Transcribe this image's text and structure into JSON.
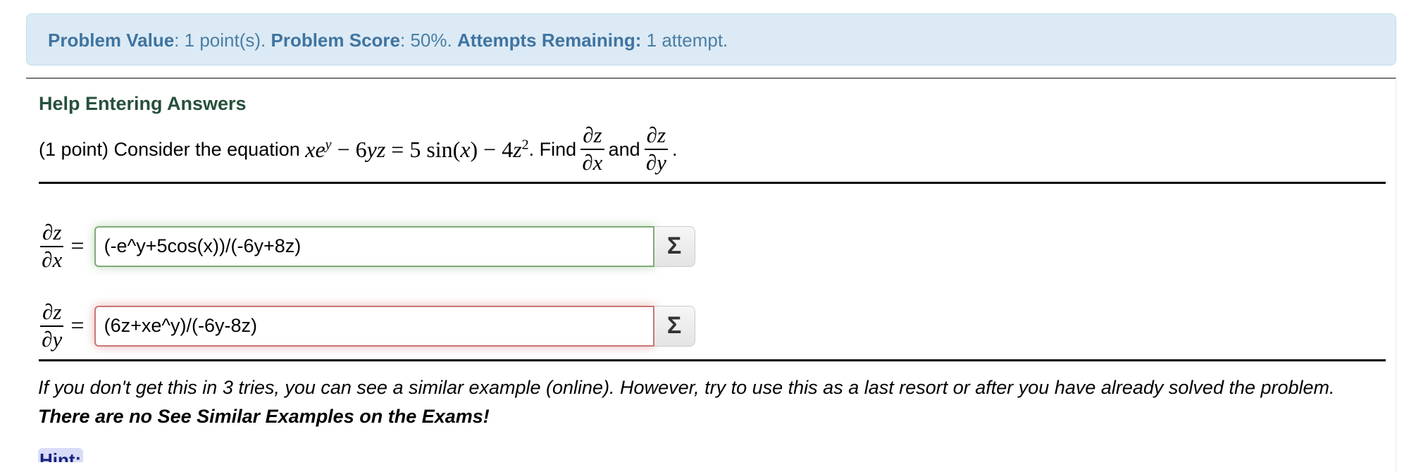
{
  "status": {
    "problem_value_label": "Problem Value",
    "problem_value": ": 1 point(s).",
    "problem_score_label": "Problem Score",
    "problem_score": ": 50%.",
    "attempts_label": "Attempts Remaining:",
    "attempts": " 1 attempt."
  },
  "help_link": "Help Entering Answers",
  "question": {
    "prefix": "(1 point) Consider the equation",
    "equation": {
      "lhs1": "xe",
      "lhs1_sup": "y",
      "minus": "−",
      "lhs2": "6yz",
      "equals": "=",
      "rhs1": "5 sin(",
      "rhs1_var": "x",
      "rhs1_close": ")",
      "rhs2": "4z",
      "rhs2_sup": "2"
    },
    "find": ". Find",
    "and": "and",
    "end": ".",
    "dz": "∂z",
    "dx": "∂x",
    "dy": "∂y"
  },
  "answers": [
    {
      "label_num": "∂z",
      "label_den": "∂x",
      "equals": "=",
      "value": "(-e^y+5cos(x))/(-6y+8z)",
      "status": "correct",
      "button_icon": "Σ"
    },
    {
      "label_num": "∂z",
      "label_den": "∂y",
      "equals": "=",
      "value": "(6z+xe^y)/(-6y-8z)",
      "status": "incorrect",
      "button_icon": "Σ"
    }
  ],
  "note": {
    "text": "If you don't get this in 3 tries, you can see a similar example (online). However, try to use this as a last resort or after you have already solved the problem. ",
    "bold": "There are no See Similar Examples on the Exams!"
  },
  "hint_label": "Hint:"
}
